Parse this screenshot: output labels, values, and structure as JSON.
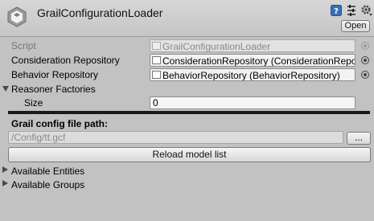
{
  "header": {
    "title": "GrailConfigurationLoader",
    "open_label": "Open",
    "icons": [
      "unity-cube-icon",
      "help-icon",
      "preset-icon",
      "gear-icon"
    ]
  },
  "fields": {
    "script": {
      "label": "Script",
      "value": "GrailConfigurationLoader"
    },
    "consideration_repository": {
      "label": "Consideration Repository",
      "value": "ConsiderationRepository (ConsiderationRepo"
    },
    "behavior_repository": {
      "label": "Behavior Repository",
      "value": "BehaviorRepository (BehaviorRepository)"
    },
    "reasoner_factories": {
      "label": "Reasoner Factories",
      "expanded": true
    },
    "size": {
      "label": "Size",
      "value": "0"
    }
  },
  "config": {
    "path_label": "Grail config file path:",
    "path_value": "/Config/tt.gcf",
    "browse_label": "...",
    "reload_label": "Reload model list"
  },
  "foldouts": {
    "available_entities": {
      "label": "Available Entities",
      "expanded": false
    },
    "available_groups": {
      "label": "Available Groups",
      "expanded": false
    }
  }
}
